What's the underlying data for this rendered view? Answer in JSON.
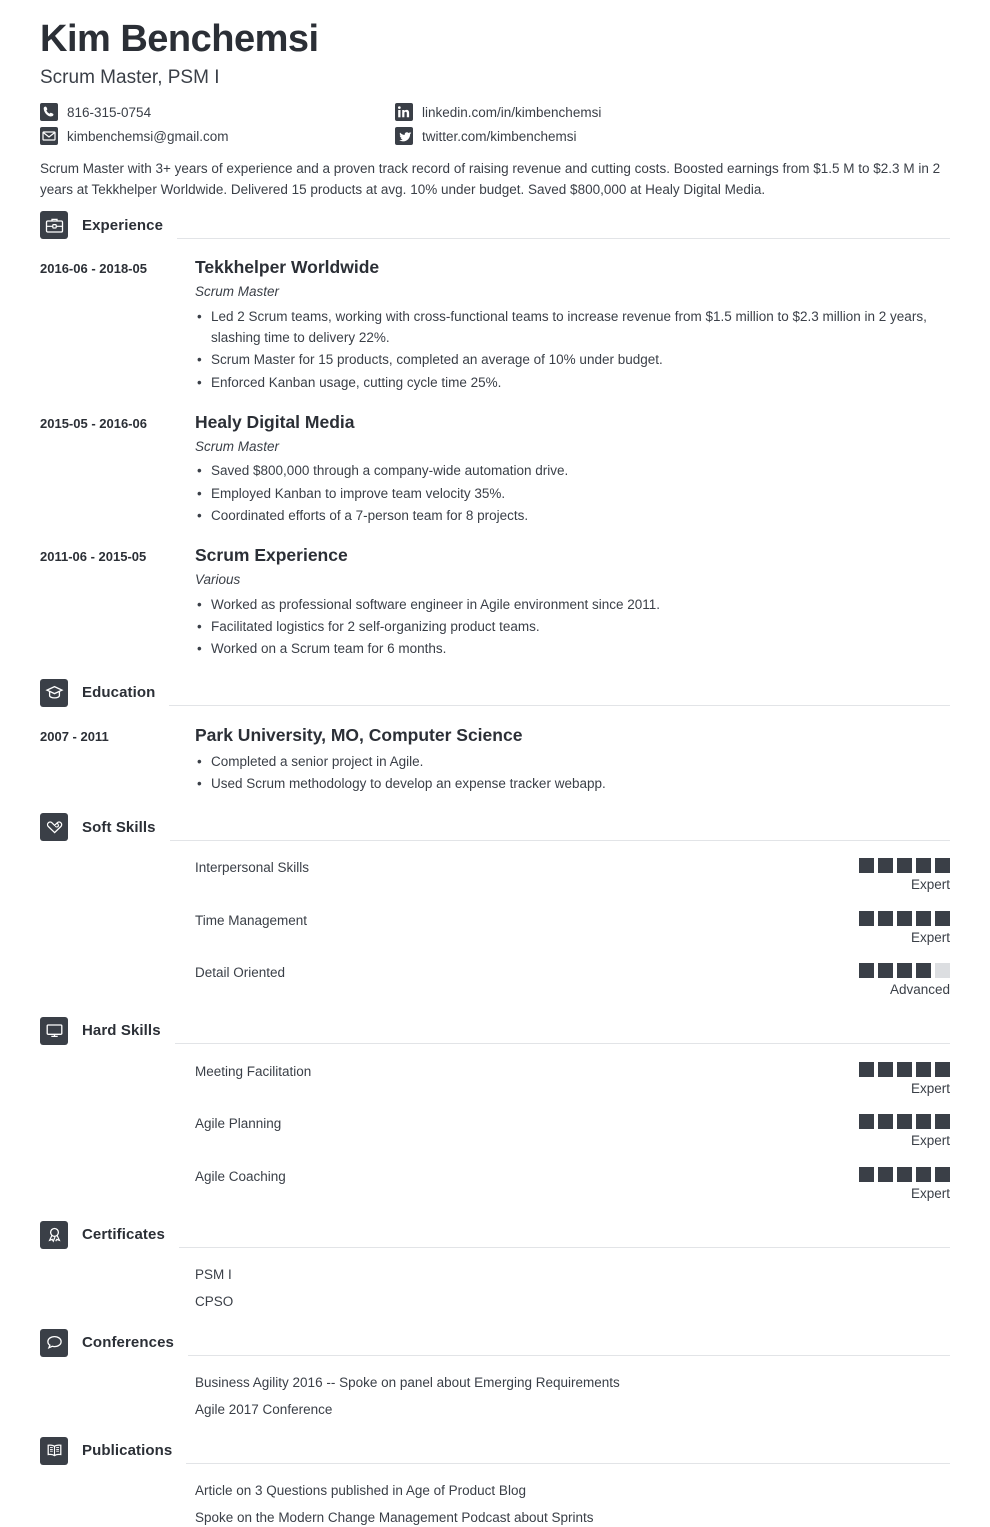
{
  "header": {
    "name": "Kim Benchemsi",
    "job_title": "Scrum Master, PSM I",
    "contacts": [
      {
        "icon": "phone-icon",
        "text": "816-315-0754"
      },
      {
        "icon": "linkedin-icon",
        "text": "linkedin.com/in/kimbenchemsi"
      },
      {
        "icon": "envelope-icon",
        "text": "kimbenchemsi@gmail.com"
      },
      {
        "icon": "twitter-icon",
        "text": "twitter.com/kimbenchemsi"
      }
    ],
    "summary": "Scrum Master with 3+ years of experience and a proven track record of raising revenue and cutting costs. Boosted earnings from $1.5 M to $2.3 M in 2 years at Tekkhelper Worldwide. Delivered 15 products at avg. 10% under budget. Saved $800,000 at Healy Digital Media."
  },
  "colors": {
    "icon_box": "#3a3f47",
    "text": "#3a3f47",
    "heading": "#2b2f36",
    "rule": "#e2e4e7",
    "square_on": "#3a3f47",
    "square_off": "#dcdee1"
  },
  "sections": {
    "experience": {
      "title": "Experience",
      "icon": "briefcase-icon",
      "entries": [
        {
          "date": "2016-06 - 2018-05",
          "org": "Tekkhelper Worldwide",
          "role": "Scrum Master",
          "bullets": [
            "Led 2 Scrum teams, working with cross-functional teams to increase revenue from $1.5 million to $2.3 million in 2 years, slashing time to delivery 22%.",
            "Scrum Master for 15 products, completed an average of 10% under budget.",
            "Enforced Kanban usage, cutting cycle time 25%."
          ]
        },
        {
          "date": "2015-05 - 2016-06",
          "org": "Healy Digital Media",
          "role": "Scrum Master",
          "bullets": [
            "Saved $800,000 through a company-wide automation drive.",
            "Employed Kanban to improve team velocity 35%.",
            "Coordinated efforts of a 7-person team for 8 projects."
          ]
        },
        {
          "date": "2011-06 - 2015-05",
          "org": "Scrum Experience",
          "role": "Various",
          "bullets": [
            "Worked as professional software engineer in Agile environment since 2011.",
            "Facilitated logistics for 2 self-organizing product teams.",
            "Worked on a Scrum team for 6 months."
          ]
        }
      ]
    },
    "education": {
      "title": "Education",
      "icon": "graduation-cap-icon",
      "entries": [
        {
          "date": "2007 - 2011",
          "org": "Park University, MO, Computer Science",
          "role": "",
          "bullets": [
            "Completed a senior project in Agile.",
            "Used Scrum methodology to develop an expense tracker webapp."
          ]
        }
      ]
    },
    "soft_skills": {
      "title": "Soft Skills",
      "icon": "handshake-heart-icon",
      "skills": [
        {
          "name": "Interpersonal Skills",
          "level": "Expert",
          "filled": 5,
          "total": 5
        },
        {
          "name": "Time Management",
          "level": "Expert",
          "filled": 5,
          "total": 5
        },
        {
          "name": "Detail Oriented",
          "level": "Advanced",
          "filled": 4,
          "total": 5
        }
      ]
    },
    "hard_skills": {
      "title": "Hard Skills",
      "icon": "monitor-icon",
      "skills": [
        {
          "name": "Meeting Facilitation",
          "level": "Expert",
          "filled": 5,
          "total": 5
        },
        {
          "name": "Agile Planning",
          "level": "Expert",
          "filled": 5,
          "total": 5
        },
        {
          "name": "Agile Coaching",
          "level": "Expert",
          "filled": 5,
          "total": 5
        }
      ]
    },
    "certificates": {
      "title": "Certificates",
      "icon": "award-ribbon-icon",
      "items": [
        "PSM I",
        "CPSO"
      ]
    },
    "conferences": {
      "title": "Conferences",
      "icon": "speech-bubble-icon",
      "items": [
        "Business Agility 2016 -- Spoke on panel about Emerging Requirements",
        "Agile 2017 Conference"
      ]
    },
    "publications": {
      "title": "Publications",
      "icon": "open-book-icon",
      "items": [
        "Article on 3 Questions published in Age of Product Blog",
        "Spoke on the Modern Change Management Podcast about Sprints"
      ]
    }
  }
}
